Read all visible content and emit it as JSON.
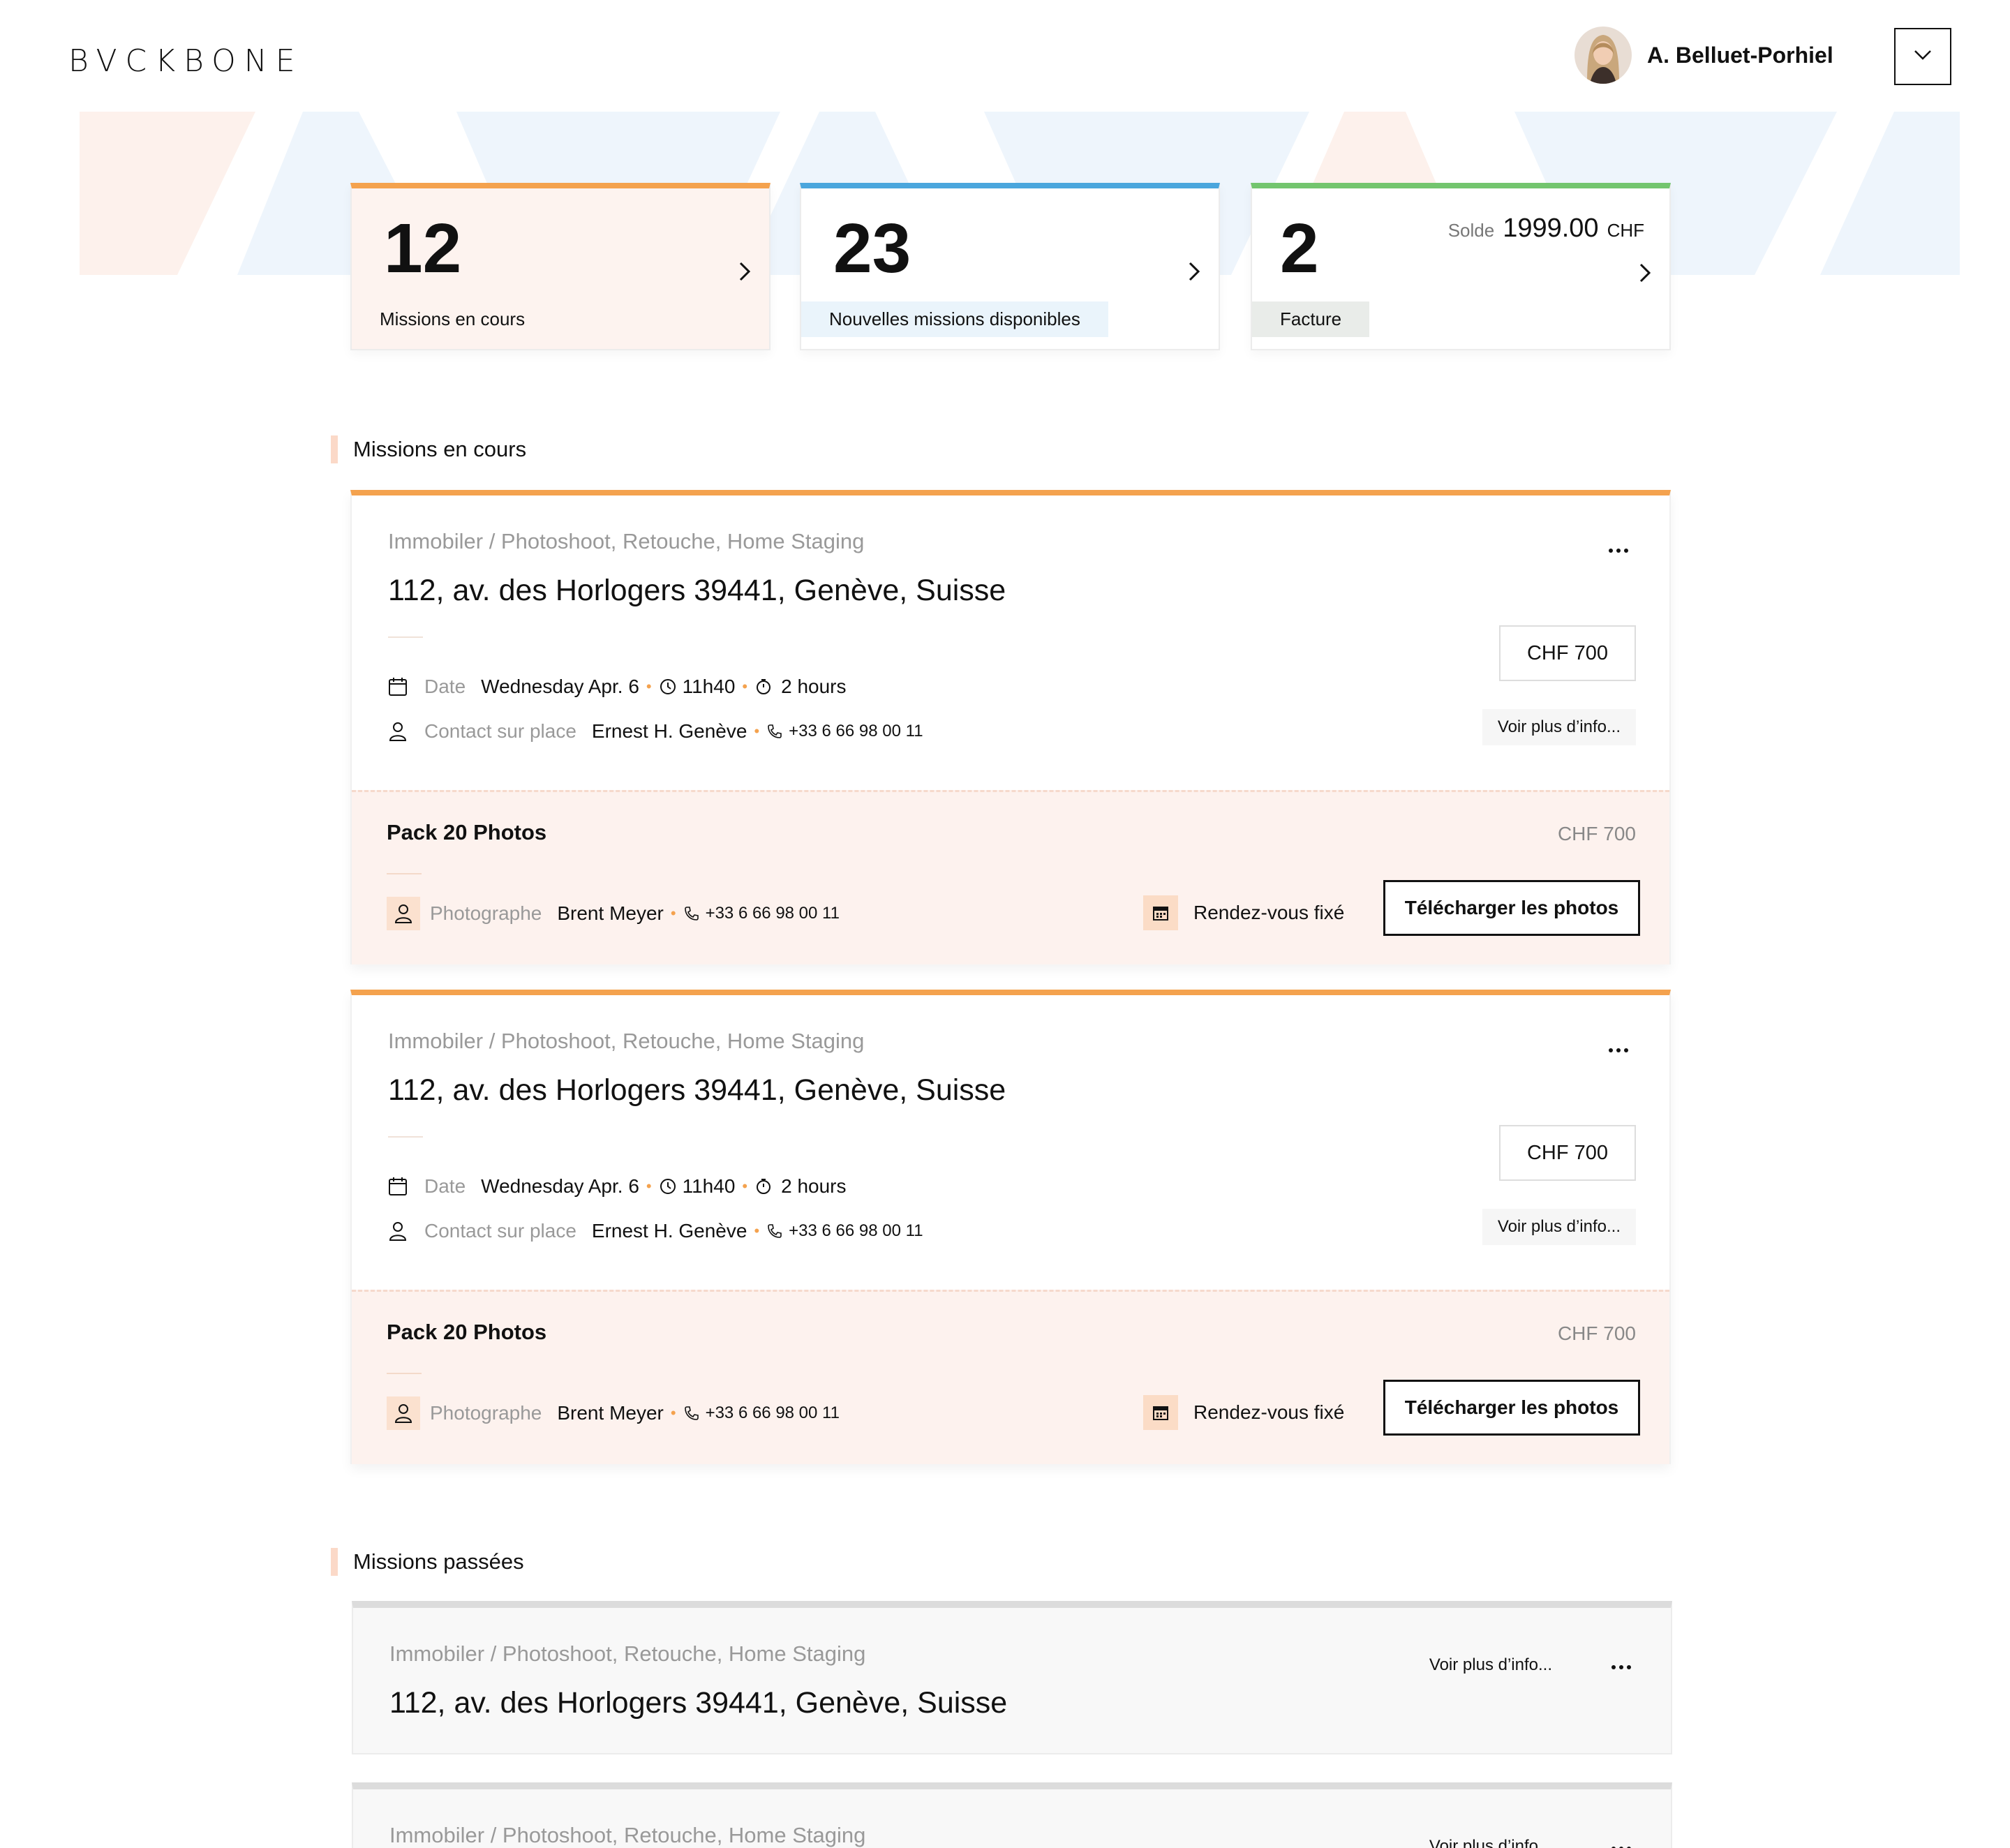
{
  "header": {
    "logo": "BVCKBONE",
    "user_name": "A. Belluet-Porhiel"
  },
  "stats": {
    "missions": {
      "count": "12",
      "label": "Missions en cours"
    },
    "nouvelles": {
      "count": "23",
      "label": "Nouvelles missions disponibles"
    },
    "facture": {
      "count": "2",
      "label": "Facture",
      "solde_label": "Solde",
      "solde_amount": "1999.00",
      "solde_currency": "CHF"
    }
  },
  "sections": {
    "current": "Missions en cours",
    "past": "Missions passées"
  },
  "missions": [
    {
      "category": "Immobiler / Photoshoot, Retouche, Home Staging",
      "address": "112, av. des Horlogers 39441, Genève, Suisse",
      "date_label": "Date",
      "date": "Wednesday Apr. 6",
      "time": "11h40",
      "duration": "2 hours",
      "contact_label": "Contact sur place",
      "contact_name": "Ernest H. Genève",
      "contact_phone": "+33 6 66 98 00 11",
      "price": "CHF 700",
      "more_info": "Voir plus d’info...",
      "pack": {
        "title": "Pack 20 Photos",
        "price": "CHF 700",
        "photographer_label": "Photographe",
        "photographer_name": "Brent Meyer",
        "photographer_phone": "+33 6 66 98 00 11",
        "status": "Rendez-vous fixé",
        "download_label": "Télécharger les photos"
      }
    },
    {
      "category": "Immobiler / Photoshoot, Retouche, Home Staging",
      "address": "112, av. des Horlogers 39441, Genève, Suisse",
      "date_label": "Date",
      "date": "Wednesday Apr. 6",
      "time": "11h40",
      "duration": "2 hours",
      "contact_label": "Contact sur place",
      "contact_name": "Ernest H. Genève",
      "contact_phone": "+33 6 66 98 00 11",
      "price": "CHF 700",
      "more_info": "Voir plus d’info...",
      "pack": {
        "title": "Pack 20 Photos",
        "price": "CHF 700",
        "photographer_label": "Photographe",
        "photographer_name": "Brent Meyer",
        "photographer_phone": "+33 6 66 98 00 11",
        "status": "Rendez-vous fixé",
        "download_label": "Télécharger les photos"
      }
    }
  ],
  "past_missions": [
    {
      "category": "Immobiler / Photoshoot, Retouche, Home Staging",
      "address": "112, av. des Horlogers 39441, Genève, Suisse",
      "more_info": "Voir plus d’info..."
    },
    {
      "category": "Immobiler / Photoshoot, Retouche, Home Staging",
      "address": "",
      "more_info": "Voir plus d’info..."
    }
  ],
  "icons": {
    "menu": "chevron-down-icon",
    "stat_arrow": "chevron-right-icon",
    "more": "more-dots-icon",
    "date": "calendar-icon",
    "time": "clock-icon",
    "duration": "timer-icon",
    "contact": "user-icon",
    "phone": "phone-icon",
    "rdv": "calendar-icon"
  },
  "colors": {
    "orange": "#f4a24e",
    "blue": "#4aa6dd",
    "green": "#73c56e",
    "peach_bg": "#fdf2ee"
  }
}
